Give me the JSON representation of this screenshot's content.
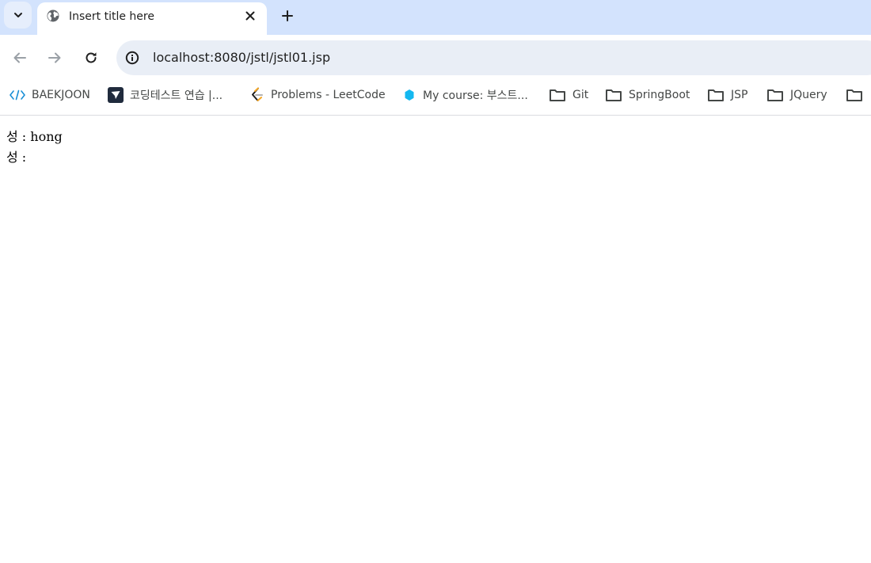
{
  "browser": {
    "tab": {
      "title": "Insert title here"
    },
    "url": "localhost:8080/jstl/jstl01.jsp",
    "bookmarks": [
      {
        "label": "BAEKJOON",
        "icon": "code-brackets-icon"
      },
      {
        "label": "코딩테스트 연습 |...",
        "icon": "programmers-icon"
      },
      {
        "label": "Problems - LeetCode",
        "icon": "leetcode-icon"
      },
      {
        "label": "My course: 부스트...",
        "icon": "boostcourse-icon"
      },
      {
        "label": "Git",
        "icon": "folder-icon"
      },
      {
        "label": "SpringBoot",
        "icon": "folder-icon"
      },
      {
        "label": "JSP",
        "icon": "folder-icon"
      },
      {
        "label": "JQuery",
        "icon": "folder-icon"
      }
    ]
  },
  "content": {
    "lines": [
      {
        "label": "성 : ",
        "value": "hong"
      },
      {
        "label": "성 : ",
        "value": ""
      }
    ]
  },
  "colors": {
    "tabstrip_bg": "#d3e3fd",
    "omnibox_bg": "#e9eef6",
    "icon_gray": "#444746"
  }
}
